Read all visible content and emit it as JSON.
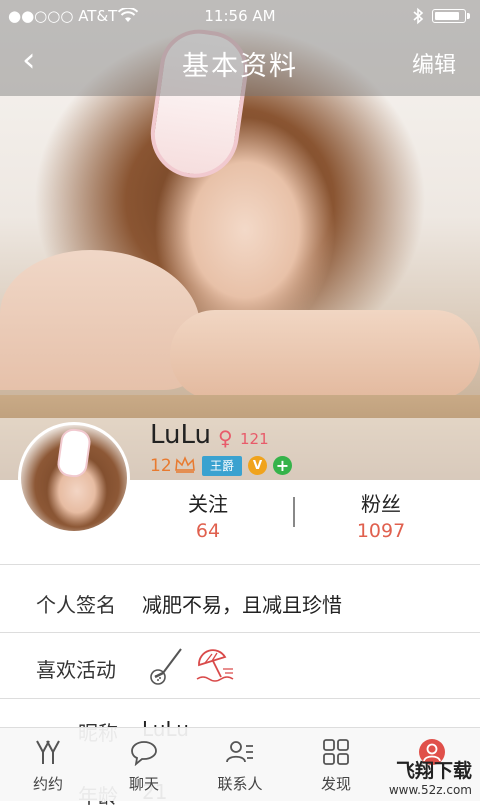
{
  "status_bar": {
    "carrier": "●●○○○ AT&T",
    "time": "11:56 AM",
    "battery_level": 0.9
  },
  "nav": {
    "back_glyph": "‹",
    "title": "基本资料",
    "edit_label": "编辑"
  },
  "profile": {
    "username": "LuLu",
    "gender_glyph": "♀",
    "age": "121",
    "level": "12",
    "badge_title": "王爵",
    "badge_v": "V",
    "badge_plus": "+"
  },
  "stats": [
    {
      "label": "关注",
      "value": "64"
    },
    {
      "label": "粉丝",
      "value": "1097"
    }
  ],
  "fields": {
    "signature_key": "个人签名",
    "signature_value": "减肥不易，且减且珍惜",
    "activities_key": "喜欢活动",
    "activities_icons": [
      "golf-icon",
      "beach-umbrella-icon"
    ],
    "nickname_key": "昵称",
    "nickname_value": "LuLu",
    "age_key": "年龄",
    "age_value": "21"
  },
  "tabs": [
    {
      "label": "约约",
      "icon": "yoyo-icon"
    },
    {
      "label": "聊天",
      "icon": "chat-bubble-icon"
    },
    {
      "label": "联系人",
      "icon": "contacts-icon"
    },
    {
      "label": "发现",
      "icon": "grid-icon"
    },
    {
      "label": "",
      "icon": "profile-icon"
    }
  ],
  "watermark": {
    "line1": "飞翔下载",
    "line2": "www.52z.com"
  },
  "colors": {
    "accent": "#e0604e",
    "badge_blue": "#3aa2d0",
    "badge_orange": "#f0a31c",
    "badge_green": "#35b34a"
  }
}
